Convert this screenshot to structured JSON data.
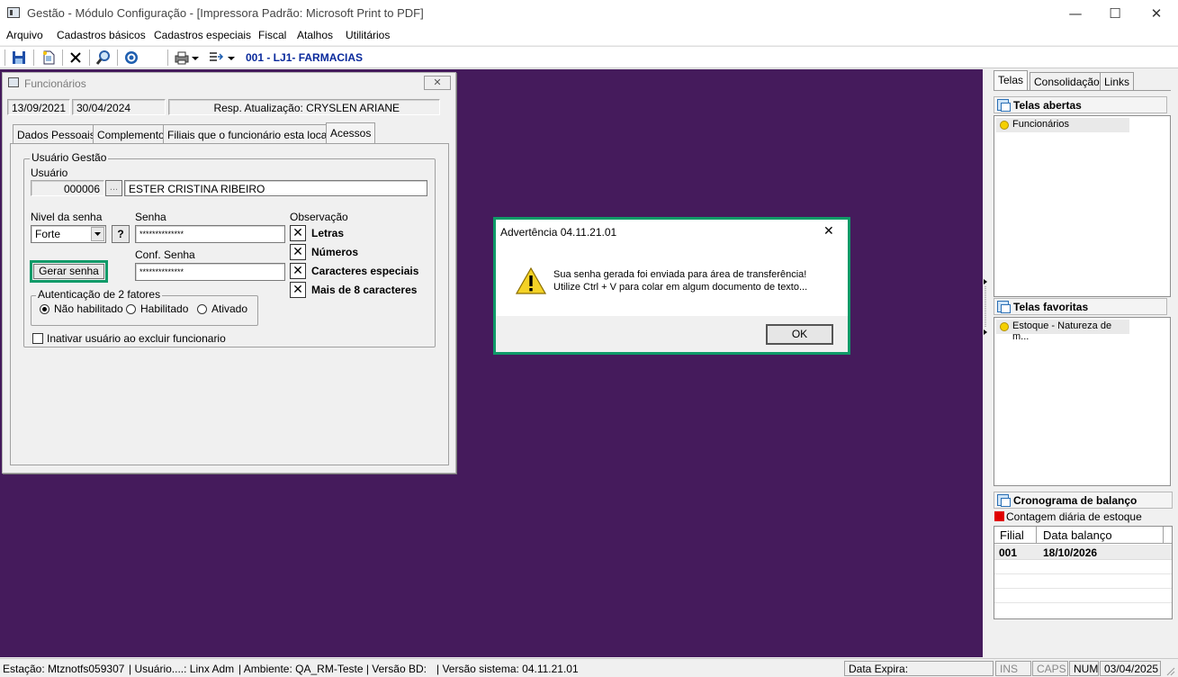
{
  "window": {
    "title": "Gestão - Módulo Configuração - [Impressora Padrão: Microsoft Print to PDF]",
    "minimize": "—",
    "maximize": "☐",
    "close": "✕"
  },
  "menu": [
    "Arquivo",
    "Cadastros básicos",
    "Cadastros especiais",
    "Fiscal",
    "Atalhos",
    "Utilitários"
  ],
  "toolbar": {
    "store": "001 - LJ1- FARMACIAS",
    "icons": [
      "save-icon",
      "new-document-icon",
      "delete-icon",
      "search-icon",
      "help-icon",
      "print-icon",
      "export-icon"
    ]
  },
  "funcionarios": {
    "title": "Funcionários",
    "close": "✕",
    "date_created": "13/09/2021",
    "date_updated": "30/04/2024",
    "resp": "Resp. Atualização: CRYSLEN ARIANE",
    "tabs": [
      "Dados Pessoais",
      "Complemento",
      "Filiais que o funcionário esta locado",
      "Acessos"
    ],
    "group_usuario": "Usuário Gestão",
    "usuario_label": "Usuário",
    "usuario_code": "000006",
    "usuario_ellipsis": "...",
    "usuario_name": "ESTER CRISTINA RIBEIRO",
    "nivel_label": "Nivel da senha",
    "nivel_value": "Forte",
    "help_button": "?",
    "senha_label": "Senha",
    "senha_value": "**************",
    "conf_senha_label": "Conf. Senha",
    "conf_senha_value": "**************",
    "gerar_senha": "Gerar senha",
    "observacao_label": "Observação",
    "observacoes": [
      "Letras",
      "Números",
      "Caracteres especiais",
      "Mais de 8 caracteres"
    ],
    "check_mark": "✕",
    "auth_label": "Autenticação de 2 fatores",
    "auth_options": [
      "Não habilitado",
      "Habilitado",
      "Ativado"
    ],
    "inativar_label": "Inativar usuário ao excluir funcionario"
  },
  "dialog": {
    "title": "Advertência 04.11.21.01",
    "close": "✕",
    "line1": "Sua senha gerada foi enviada para área de transferência!",
    "line2": "Utilize Ctrl + V para colar em algum documento de texto...",
    "ok": "OK"
  },
  "rightpanel": {
    "tabs": [
      "Telas",
      "Consolidação",
      "Links"
    ],
    "telas_abertas": "Telas abertas",
    "abertas_items": [
      "Funcionários"
    ],
    "telas_favoritas": "Telas favoritas",
    "favoritas_items": [
      "Estoque - Natureza de m..."
    ],
    "cronograma": "Cronograma de balanço",
    "legend": "Contagem diária de estoque",
    "legend_color": "#e00000",
    "table_headers": [
      "Filial",
      "Data balanço"
    ],
    "table_rows": [
      [
        "001",
        "18/10/2026"
      ]
    ]
  },
  "statusbar": {
    "estacao": "Estação: Mtznotfs059307",
    "usuario": "| Usuário....: Linx Adm",
    "ambiente": "| Ambiente: QA_RM-Teste | Versão BD:",
    "versao": "| Versão sistema: 04.11.21.01",
    "data_expira": "Data Expira:",
    "ins": "INS",
    "caps": "CAPS",
    "num": "NUM",
    "date": "03/04/2025"
  }
}
